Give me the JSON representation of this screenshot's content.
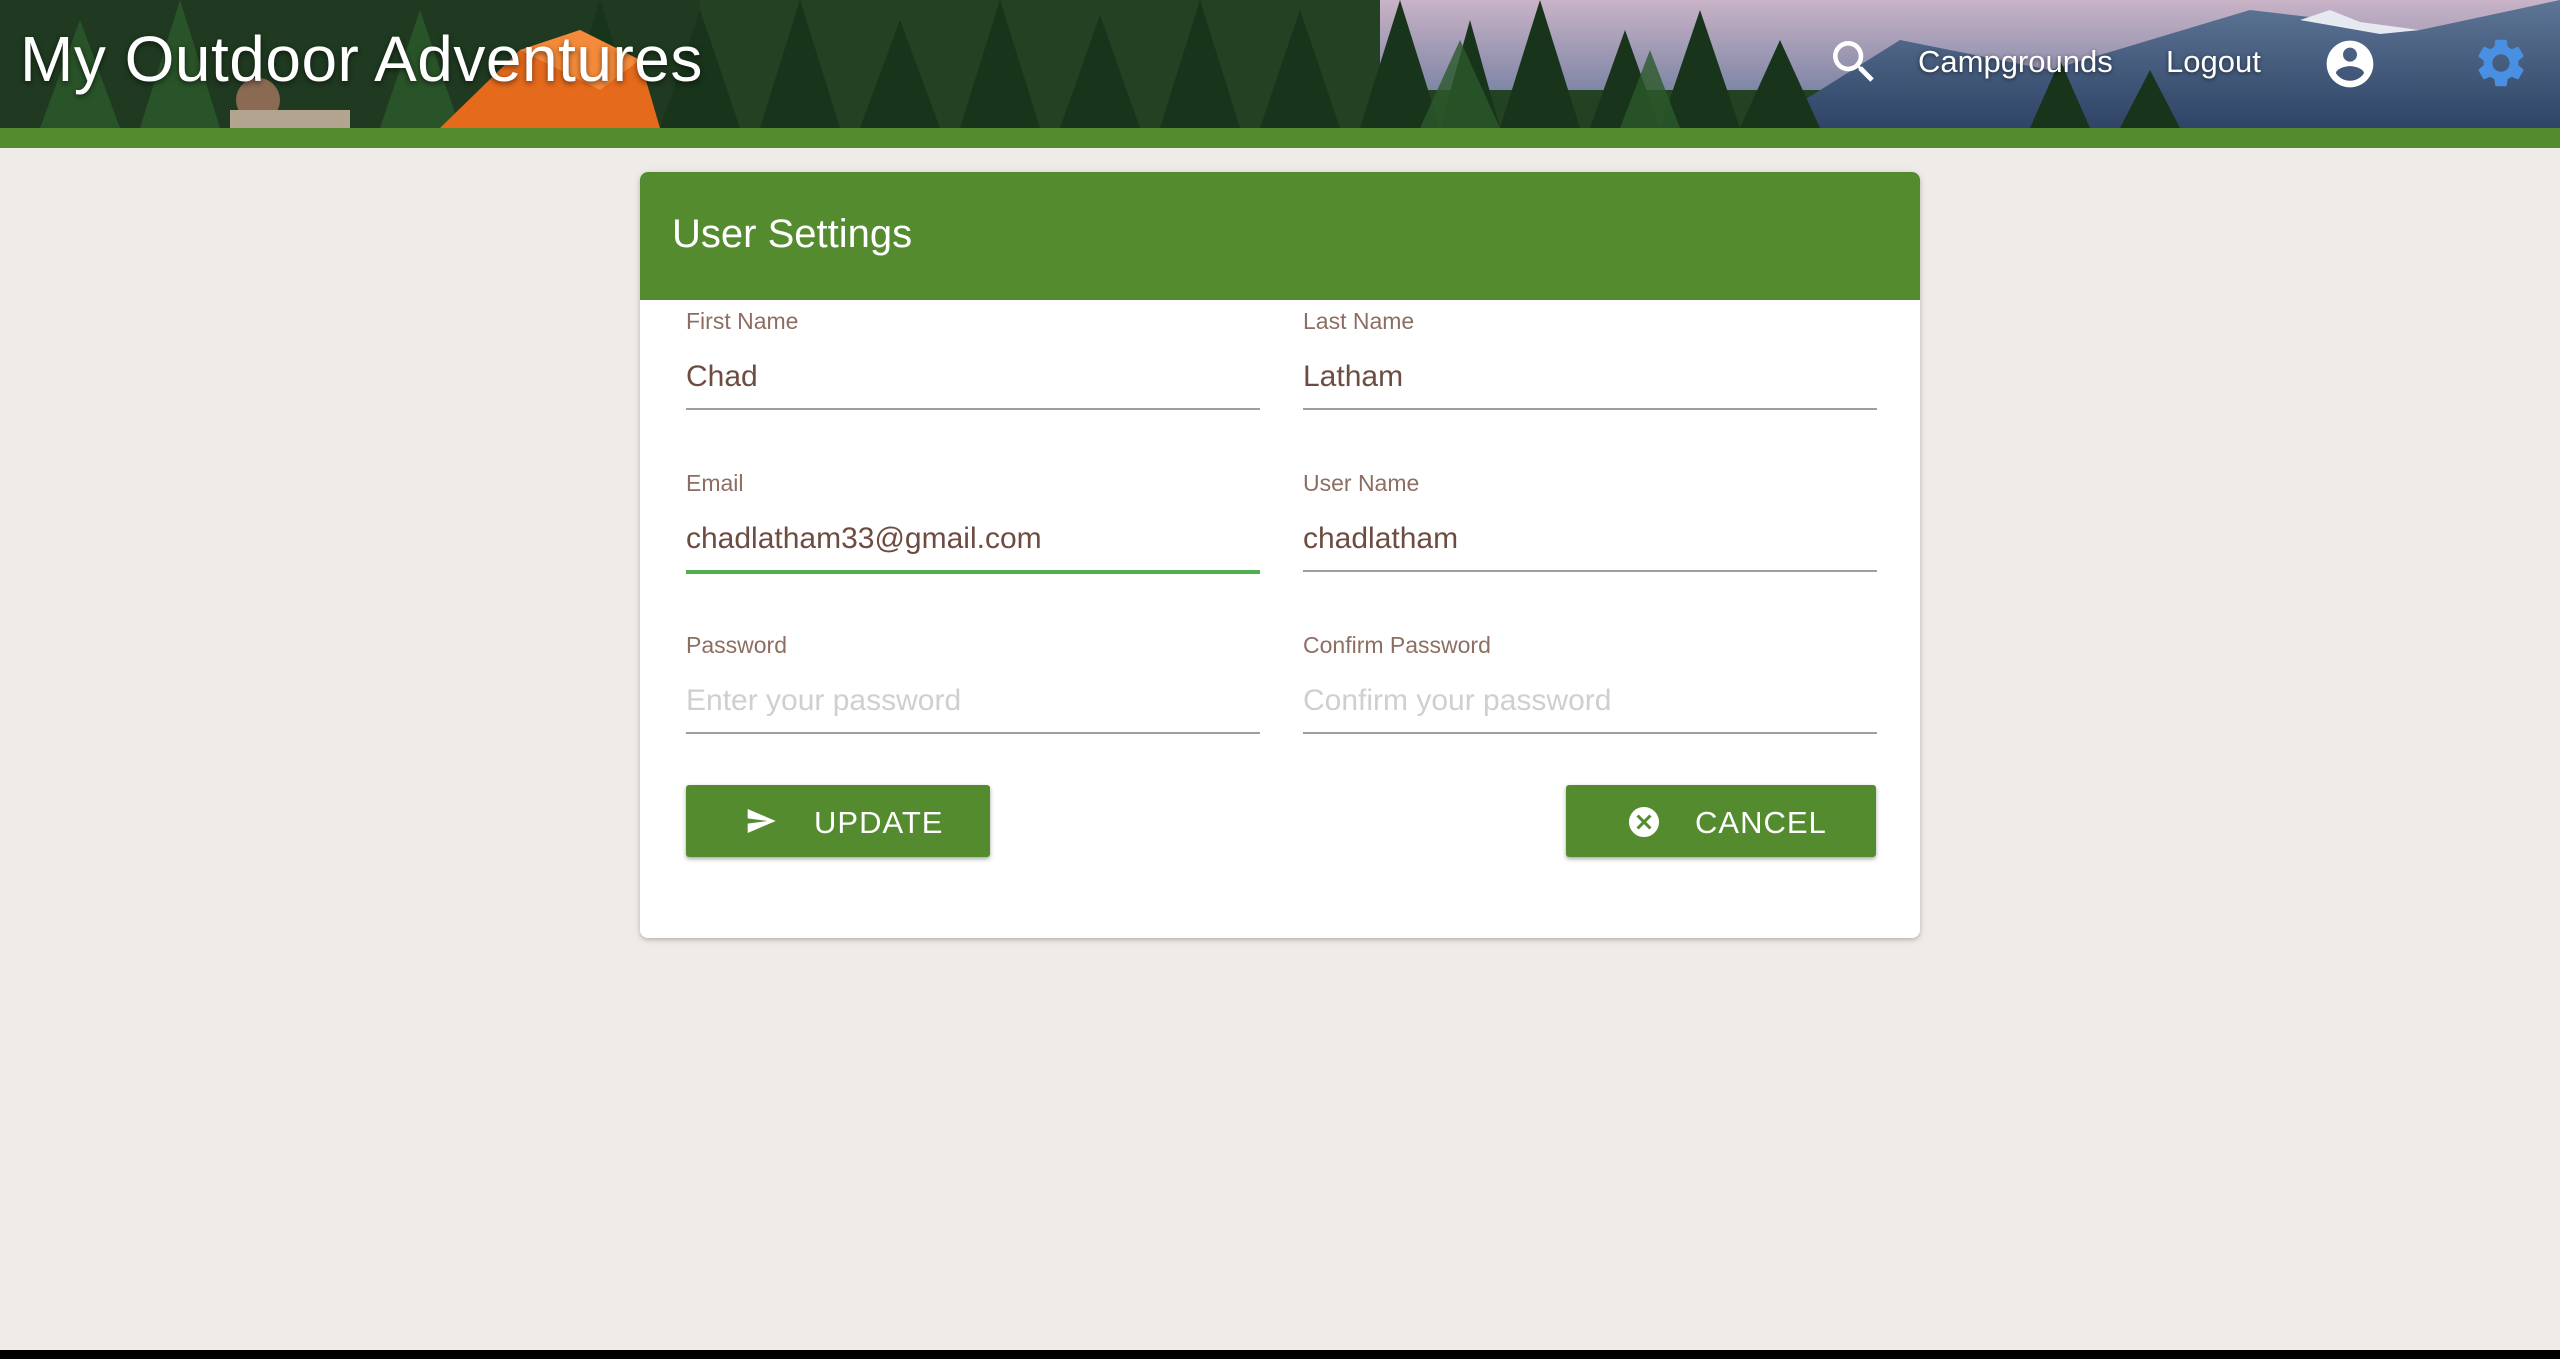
{
  "header": {
    "title": "My Outdoor Adventures",
    "nav": {
      "search_icon": "search-icon",
      "campgrounds_label": "Campgrounds",
      "logout_label": "Logout",
      "account_icon": "account-circle-icon",
      "settings_icon": "gear-icon"
    }
  },
  "settings_form": {
    "title": "User Settings",
    "first_name": {
      "label": "First Name",
      "value": "Chad",
      "placeholder": ""
    },
    "last_name": {
      "label": "Last Name",
      "value": "Latham",
      "placeholder": ""
    },
    "email": {
      "label": "Email",
      "value": "chadlatham33@gmail.com",
      "placeholder": ""
    },
    "user_name": {
      "label": "User Name",
      "value": "chadlatham",
      "placeholder": ""
    },
    "password": {
      "label": "Password",
      "value": "",
      "placeholder": "Enter your password"
    },
    "confirm_password": {
      "label": "Confirm Password",
      "value": "",
      "placeholder": "Confirm your password"
    },
    "update_button": {
      "label": "UPDATE",
      "icon": "send-icon"
    },
    "cancel_button": {
      "label": "CANCEL",
      "icon": "cancel-circle-icon"
    }
  },
  "colors": {
    "primary_green": "#558b2f",
    "focus_underline": "#4caf50",
    "label_brown": "#8d6e63",
    "value_brown": "#6d4c41",
    "page_background": "#efebe8",
    "settings_icon_blue": "#4a90e2"
  }
}
